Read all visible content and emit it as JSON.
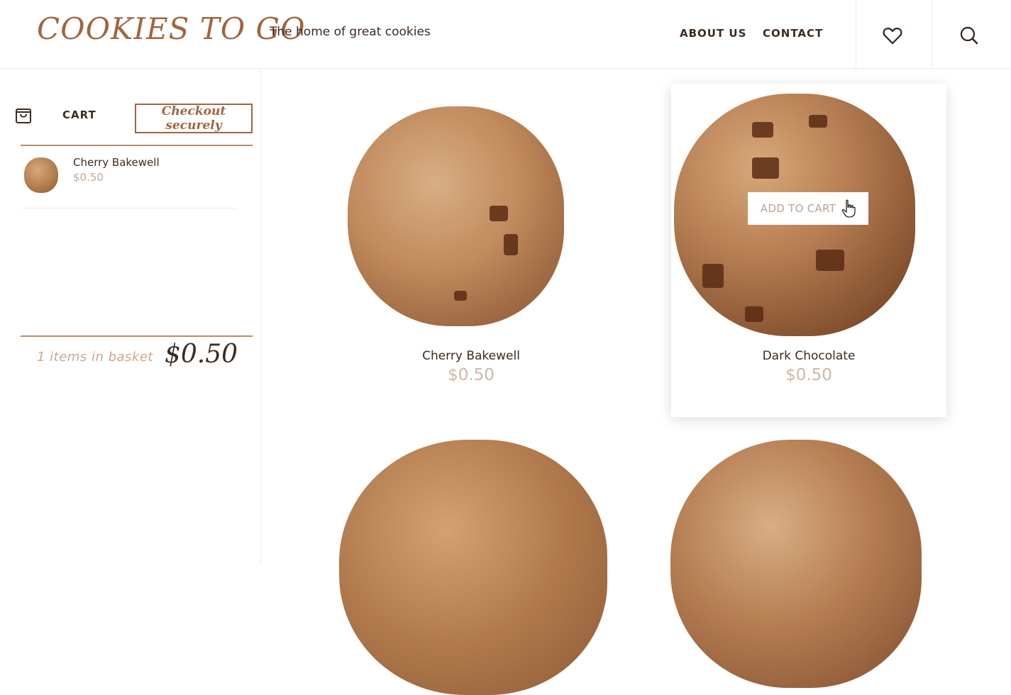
{
  "header": {
    "brand": "COOKIES TO GO",
    "tagline": "The home of great cookies",
    "nav": [
      {
        "label": "ABOUT US"
      },
      {
        "label": "CONTACT"
      }
    ],
    "icons": [
      "heart-icon",
      "search-icon"
    ]
  },
  "cart": {
    "label": "CART",
    "checkout_label": "Checkout securely",
    "items": [
      {
        "name": "Cherry Bakewell",
        "price": "$0.50"
      }
    ],
    "summary_count": "1 items in basket",
    "summary_total": "$0.50"
  },
  "products": [
    {
      "name": "Cherry Bakewell",
      "price": "$0.50"
    },
    {
      "name": "Dark Chocolate",
      "price": "$0.50",
      "add_to_cart_label": "ADD TO CART"
    }
  ],
  "colors": {
    "brand": "#a0653f",
    "price_muted": "#d0b7a5",
    "text": "#3d2b20"
  }
}
